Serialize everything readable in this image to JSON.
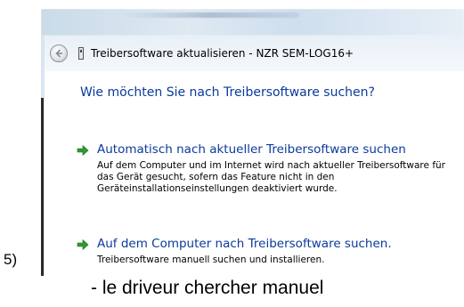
{
  "step_label": "5)",
  "caption": "- le driveur chercher manuel",
  "window": {
    "title": "Treibersoftware aktualisieren - NZR SEM-LOG16+",
    "heading": "Wie möchten Sie nach Treibersoftware suchen?",
    "options": [
      {
        "title": "Automatisch nach aktueller Treibersoftware suchen",
        "description": "Auf dem Computer und im Internet wird nach aktueller Treibersoftware für das Gerät gesucht, sofern das Feature nicht in den Geräteinstallationseinstellungen deaktiviert wurde."
      },
      {
        "title": "Auf dem Computer nach Treibersoftware suchen.",
        "description": "Treibersoftware manuell suchen und installieren."
      }
    ]
  },
  "icons": {
    "back": "back-arrow-icon",
    "device": "device-icon",
    "option_arrow": "green-arrow-icon"
  },
  "colors": {
    "link_blue": "#0b3a9b",
    "arrow_green": "#2e9b2e"
  }
}
